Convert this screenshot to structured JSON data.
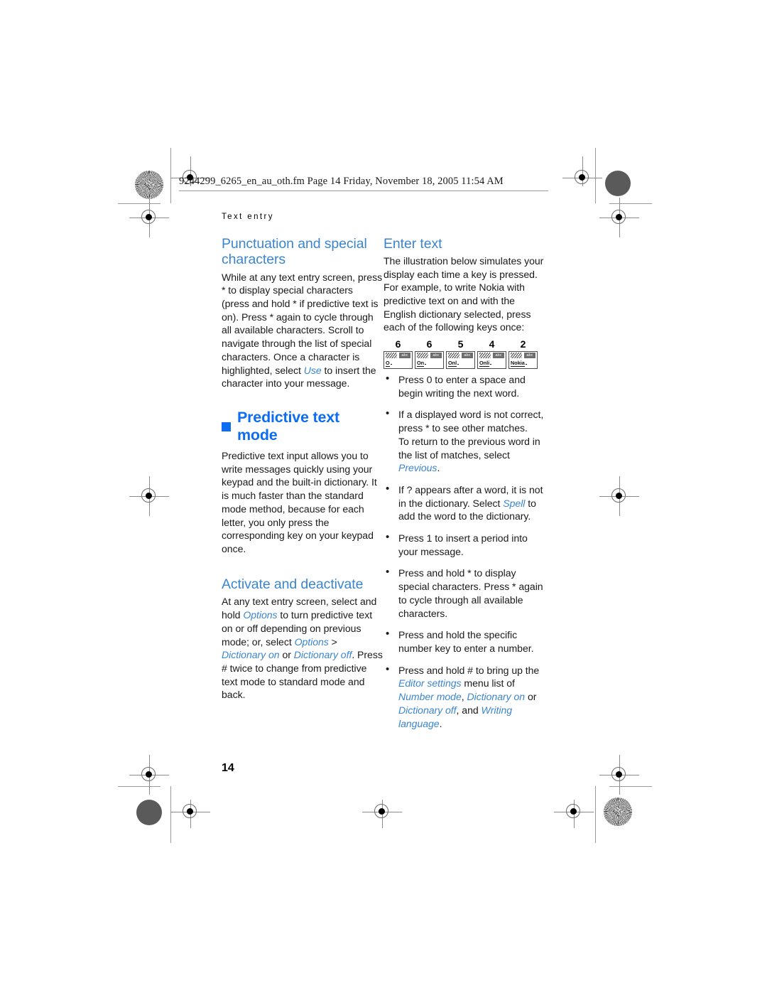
{
  "document": {
    "fm_header": "9244299_6265_en_au_oth.fm  Page 14  Friday, November 18, 2005  11:54 AM",
    "running_head": "Text entry",
    "page_number": "14"
  },
  "colors": {
    "heading_blue": "#3b85cf",
    "chapter_blue": "#0c6df2",
    "body_black": "#1a1a1a"
  },
  "left_column": {
    "section1": {
      "heading": "Punctuation and special characters",
      "paragraph_parts": [
        {
          "text": "While at any text entry screen, press * to display special characters (press and hold * if predictive text is on). Press * again to cycle through all available characters. Scroll to navigate through the list of special characters. Once a character is highlighted, select ",
          "style": "normal"
        },
        {
          "text": "Use",
          "style": "ui"
        },
        {
          "text": " to insert the character into your message.",
          "style": "normal"
        }
      ]
    },
    "chapter": {
      "bullet_icon": "filled-square-icon",
      "title": "Predictive text mode",
      "paragraph": "Predictive text input allows you to write messages quickly using your keypad and the built-in dictionary. It is much faster than the standard mode method, because for each letter, you only press the corresponding key on your keypad once."
    },
    "section2": {
      "heading": "Activate and deactivate",
      "paragraph_parts": [
        {
          "text": "At any text entry screen, select and hold ",
          "style": "normal"
        },
        {
          "text": "Options",
          "style": "ui"
        },
        {
          "text": " to turn predictive text on or off depending on previous mode; or, select ",
          "style": "normal"
        },
        {
          "text": "Options",
          "style": "ui"
        },
        {
          "text": " > ",
          "style": "normal"
        },
        {
          "text": "Dictionary on",
          "style": "ui"
        },
        {
          "text": " or ",
          "style": "normal"
        },
        {
          "text": "Dictionary off",
          "style": "ui"
        },
        {
          "text": ". Press # twice to change from predictive text mode to standard mode and back.",
          "style": "normal"
        }
      ]
    }
  },
  "right_column": {
    "heading": "Enter text",
    "paragraph": "The illustration below simulates your display each time a key is pressed. For example, to write Nokia with predictive text on and with the English dictionary selected, press each of the following keys once:",
    "key_sequence": [
      {
        "key": "6",
        "display": "O",
        "indicator_left": "predictive-text-icon",
        "indicator_right": "abc"
      },
      {
        "key": "6",
        "display": "On",
        "indicator_left": "predictive-text-icon",
        "indicator_right": "abc"
      },
      {
        "key": "5",
        "display": "Onl",
        "indicator_left": "predictive-text-icon",
        "indicator_right": "abc"
      },
      {
        "key": "4",
        "display": "Onli",
        "indicator_left": "predictive-text-icon",
        "indicator_right": "abc"
      },
      {
        "key": "2",
        "display": "Nokia",
        "indicator_left": "predictive-text-icon",
        "indicator_right": "abc"
      }
    ],
    "bullets": [
      [
        {
          "text": "Press 0 to enter a space and begin writing the next word.",
          "style": "normal"
        }
      ],
      [
        {
          "text": "If a displayed word is not correct, press * to see other matches.",
          "style": "normal"
        },
        {
          "text": "\nTo return to the previous word in the list of matches, select ",
          "style": "normal"
        },
        {
          "text": "Previous",
          "style": "ui"
        },
        {
          "text": ".",
          "style": "normal"
        }
      ],
      [
        {
          "text": "If ? appears after a word, it is not in the dictionary. Select ",
          "style": "normal"
        },
        {
          "text": "Spell",
          "style": "ui"
        },
        {
          "text": " to add the word to the dictionary.",
          "style": "normal"
        }
      ],
      [
        {
          "text": "Press 1 to insert a period into your message.",
          "style": "normal"
        }
      ],
      [
        {
          "text": "Press and hold * to display special characters. Press * again to cycle through all available characters.",
          "style": "normal"
        }
      ],
      [
        {
          "text": "Press and hold the specific number key to enter a number.",
          "style": "normal"
        }
      ],
      [
        {
          "text": "Press and hold # to bring up the ",
          "style": "normal"
        },
        {
          "text": "Editor settings",
          "style": "ui"
        },
        {
          "text": " menu list of ",
          "style": "normal"
        },
        {
          "text": "Number mode",
          "style": "ui"
        },
        {
          "text": ", ",
          "style": "normal"
        },
        {
          "text": "Dictionary on",
          "style": "ui"
        },
        {
          "text": " or ",
          "style": "normal"
        },
        {
          "text": "Dictionary off",
          "style": "ui"
        },
        {
          "text": ", and ",
          "style": "normal"
        },
        {
          "text": "Writing language",
          "style": "ui"
        },
        {
          "text": ".",
          "style": "normal"
        }
      ]
    ]
  }
}
